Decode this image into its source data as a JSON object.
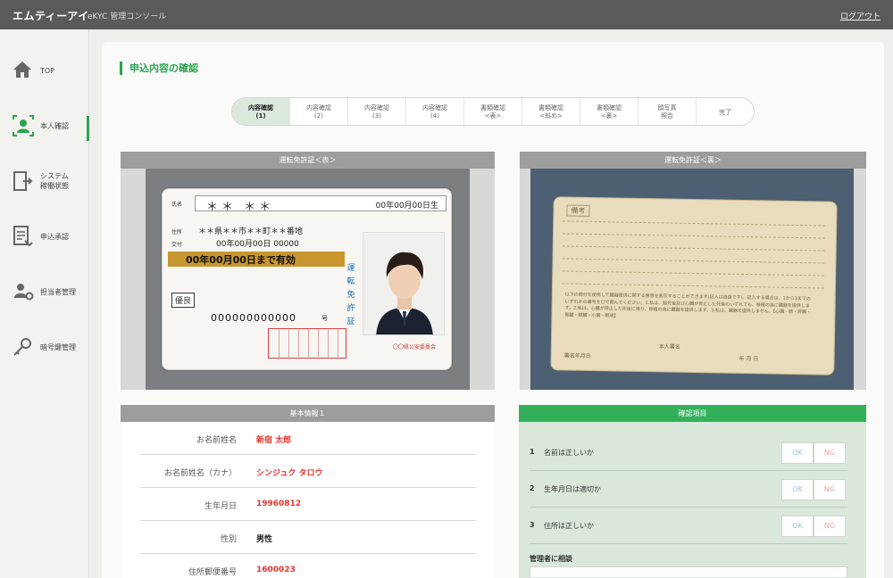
{
  "header": {
    "logo": "エムティーアイ",
    "console_title": "eKYC 管理コンソール",
    "logout": "ログアウト"
  },
  "sidebar": {
    "items": [
      {
        "label": "TOP",
        "icon": "home-icon"
      },
      {
        "label": "本人確認",
        "icon": "person-icon",
        "active": true
      },
      {
        "label": "システム\n稼働状態",
        "icon": "system-icon"
      },
      {
        "label": "申込承認",
        "icon": "document-icon"
      },
      {
        "label": "担当者管理",
        "icon": "staff-icon"
      },
      {
        "label": "暗号鍵管理",
        "icon": "key-icon"
      }
    ]
  },
  "page_title": "申込内容の確認",
  "stepper": {
    "steps": [
      "内容確認\n(1)",
      "内容確認\n(2)",
      "内容確認\n(3)",
      "内容確認\n(4)",
      "書類確認\n<表>",
      "書類確認\n<斜め>",
      "書類確認\n<裏>",
      "顔写真\n照合",
      "完了"
    ],
    "active_index": 0
  },
  "license_front": {
    "header": "運転免許証＜表＞",
    "name_label": "氏名",
    "name": "＊＊  ＊＊",
    "birth": "00年00月00日生",
    "address_label": "住所",
    "address": "＊＊県＊＊市＊＊町＊＊番地",
    "issue_label": "交付",
    "issue": "00年00月00日  00000",
    "valid": "00年00月00日まで有効",
    "class": "優良",
    "number": "000000000000",
    "number_suffix": "号",
    "vertical": "運転免許証",
    "seal": "〇〇県公安委員会"
  },
  "license_back": {
    "header": "運転免許証＜裏＞",
    "notes_label": "備考",
    "fine_print": "以下の部分を使用して臓器提供に関する意思を表示することができます(記入は自由です)。記入する場合は、1から3までのいずれかの番号を〇で囲んでください。1.私は、脳死後及び心臓が停止した死後のいずれでも、移植の為に臓器を提供します。2.私は、心臓が停止した死後に限り、移植の為に臓器を提供します。3.私は、臓器を提供しません。【心臓・肺・肝臓・腎臓・膵臓・小腸・眼球】",
    "signature_label": "署名年月日",
    "family_label": "本人署名",
    "date_label": "年  月  日"
  },
  "basic_info": {
    "header": "基本情報１",
    "rows": [
      {
        "label": "お名前姓名",
        "value": "新宿 太郎"
      },
      {
        "label": "お名前姓名（カナ）",
        "value": "シンジュク タロウ"
      },
      {
        "label": "生年月日",
        "value": "19960812"
      },
      {
        "label": "性別",
        "value": "男性"
      },
      {
        "label": "住所郵便番号",
        "value": "1600023"
      }
    ]
  },
  "check_items": {
    "header": "確認項目",
    "items": [
      {
        "num": "1",
        "text": "名前は正しいか"
      },
      {
        "num": "2",
        "text": "生年月日は適切か"
      },
      {
        "num": "3",
        "text": "住所は正しいか"
      }
    ],
    "ok_label": "OK",
    "ng_label": "NG",
    "manager_label": "管理者に相談"
  },
  "colors": {
    "accent": "#2aa44f",
    "header_bg": "#5a5a5a",
    "value_red": "#e1362e"
  }
}
